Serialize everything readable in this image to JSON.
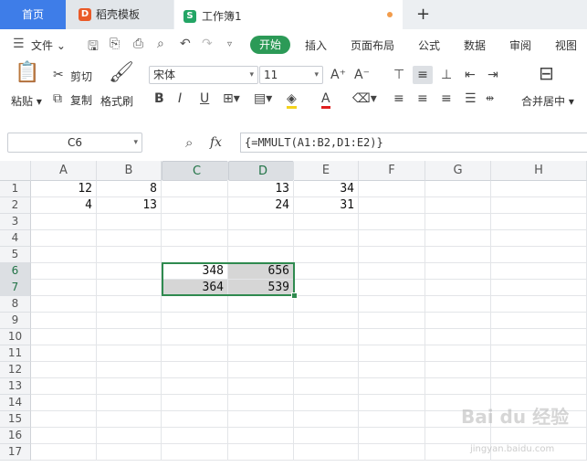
{
  "tabs": {
    "home": "首页",
    "templates": "稻壳模板",
    "workbook": "工作簿1",
    "new_tab_icon": "+"
  },
  "menu": {
    "file": "文件",
    "items": [
      "开始",
      "插入",
      "页面布局",
      "公式",
      "数据",
      "审阅",
      "视图"
    ]
  },
  "ribbon": {
    "paste": "粘贴",
    "cut": "剪切",
    "copy": "复制",
    "format_painter": "格式刷",
    "font_name": "宋体",
    "font_size": "11",
    "bold": "B",
    "italic": "I",
    "underline": "U",
    "merge_center": "合并居中"
  },
  "formula_bar": {
    "name_box": "C6",
    "fx_label": "fx",
    "formula": "{=MMULT(A1:B2,D1:E2)}"
  },
  "columns": [
    "A",
    "B",
    "C",
    "D",
    "E",
    "F",
    "G",
    "H"
  ],
  "rows": [
    "1",
    "2",
    "3",
    "4",
    "5",
    "6",
    "7",
    "8",
    "9",
    "10",
    "11",
    "12",
    "13",
    "14",
    "15",
    "16",
    "17"
  ],
  "cells": {
    "A1": "12",
    "B1": "8",
    "D1": "13",
    "E1": "34",
    "A2": "4",
    "B2": "13",
    "D2": "24",
    "E2": "31",
    "C6": "348",
    "D6": "656",
    "C7": "364",
    "D7": "539"
  },
  "watermark": "Bai du 经验",
  "watermark_sub": "jingyan.baidu.com",
  "colors": {
    "accent_blue": "#3e7de8",
    "start_green": "#2c9a57",
    "selection_green": "#2f8a4f"
  }
}
